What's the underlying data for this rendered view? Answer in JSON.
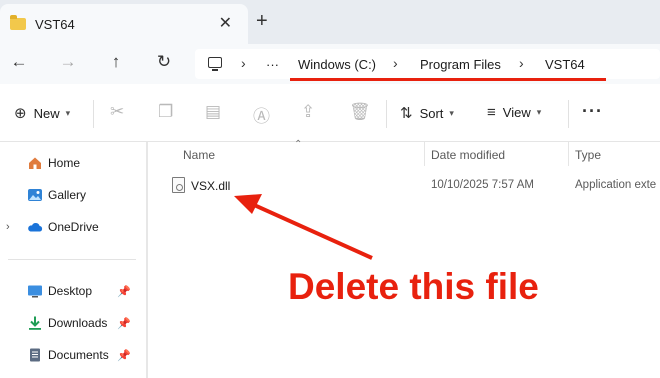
{
  "window": {
    "tab_title": "VST64",
    "tab_close": "✕",
    "new_tab": "+"
  },
  "nav": {
    "back": "←",
    "forward": "→",
    "up": "↑",
    "refresh": "↻",
    "overflow": "···",
    "breadcrumb": [
      "Windows (C:)",
      "Program Files",
      "VST64"
    ],
    "separator": "›"
  },
  "commands": {
    "new_label": "New",
    "sort_label": "Sort",
    "view_label": "View",
    "more": "···",
    "disabled_icons": [
      "cut-icon",
      "copy-icon",
      "paste-icon",
      "rename-icon",
      "share-icon",
      "delete-icon"
    ]
  },
  "sidebar": {
    "items": [
      {
        "label": "Home",
        "icon": "home-icon",
        "pinned": false
      },
      {
        "label": "Gallery",
        "icon": "gallery-icon",
        "pinned": false
      },
      {
        "label": "OneDrive",
        "icon": "onedrive-icon",
        "pinned": false,
        "expandable": true
      },
      {
        "label": "Desktop",
        "icon": "desktop-icon",
        "pinned": true
      },
      {
        "label": "Downloads",
        "icon": "downloads-icon",
        "pinned": true
      },
      {
        "label": "Documents",
        "icon": "documents-icon",
        "pinned": true
      }
    ]
  },
  "filelist": {
    "columns": [
      "Name",
      "Date modified",
      "Type"
    ],
    "rows": [
      {
        "name": "VSX.dll",
        "date": "10/10/2025 7:57 AM",
        "type": "Application exte",
        "icon": "dll-file-icon"
      }
    ]
  },
  "annotation": {
    "text": "Delete this file",
    "color": "#e8210e"
  }
}
